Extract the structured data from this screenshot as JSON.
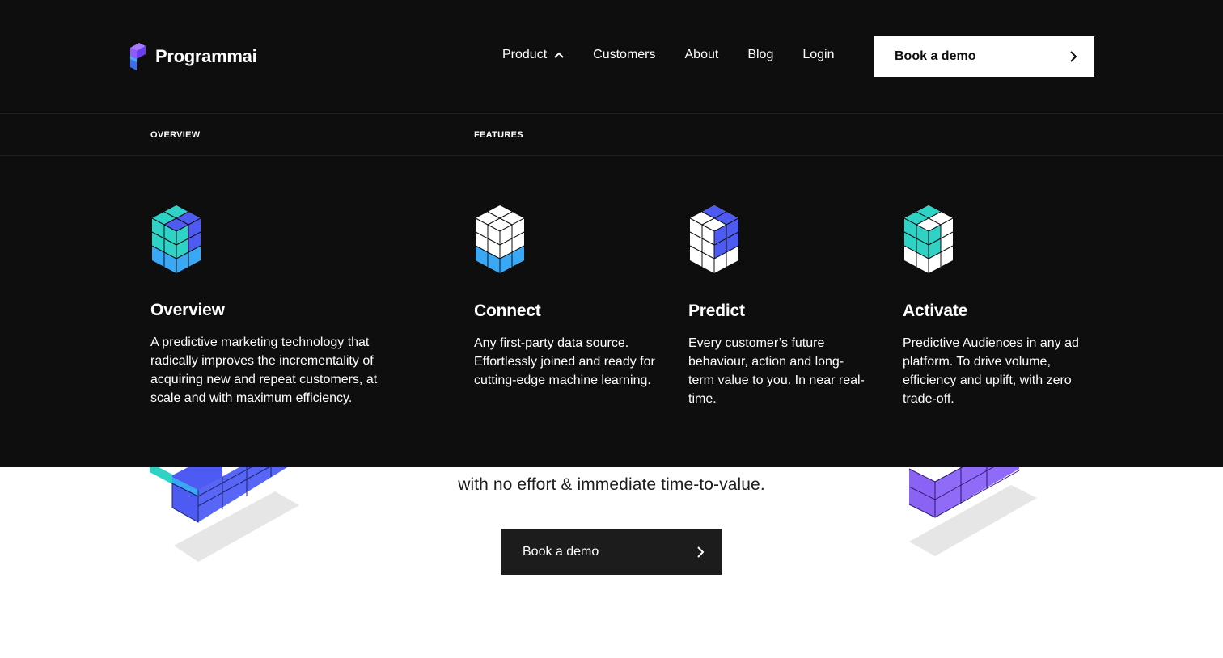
{
  "brand": {
    "name": "Programmai"
  },
  "nav": {
    "items": [
      {
        "label": "Product"
      },
      {
        "label": "Customers"
      },
      {
        "label": "About"
      },
      {
        "label": "Blog"
      },
      {
        "label": "Login"
      }
    ],
    "cta_label": "Book a demo"
  },
  "menu": {
    "overview_label": "OVERVIEW",
    "features_label": "FEATURES",
    "cards": [
      {
        "title": "Overview",
        "description": "A predictive marketing technology that radically improves the incrementality of acquiring new and repeat customers, at scale and with maximum efficiency."
      },
      {
        "title": "Connect",
        "description": "Any first-party data source. Effortlessly joined and ready for cutting-edge machine learning."
      },
      {
        "title": "Predict",
        "description": "Every customer’s future behaviour, action and long-term value to you. In near real-time."
      },
      {
        "title": "Activate",
        "description": "Predictive Audiences in any ad platform. To drive volume, efficiency and uplift, with zero trade-off."
      }
    ]
  },
  "hero": {
    "subtitle": "with no effort & immediate time-to-value.",
    "cta_label": "Book a demo"
  },
  "colors": {
    "teal": "#2ed3c6",
    "sky": "#3aa8f5",
    "indigo": "#4e5bf2",
    "violet": "#8a63f5",
    "dark": "#0e0e0e"
  }
}
